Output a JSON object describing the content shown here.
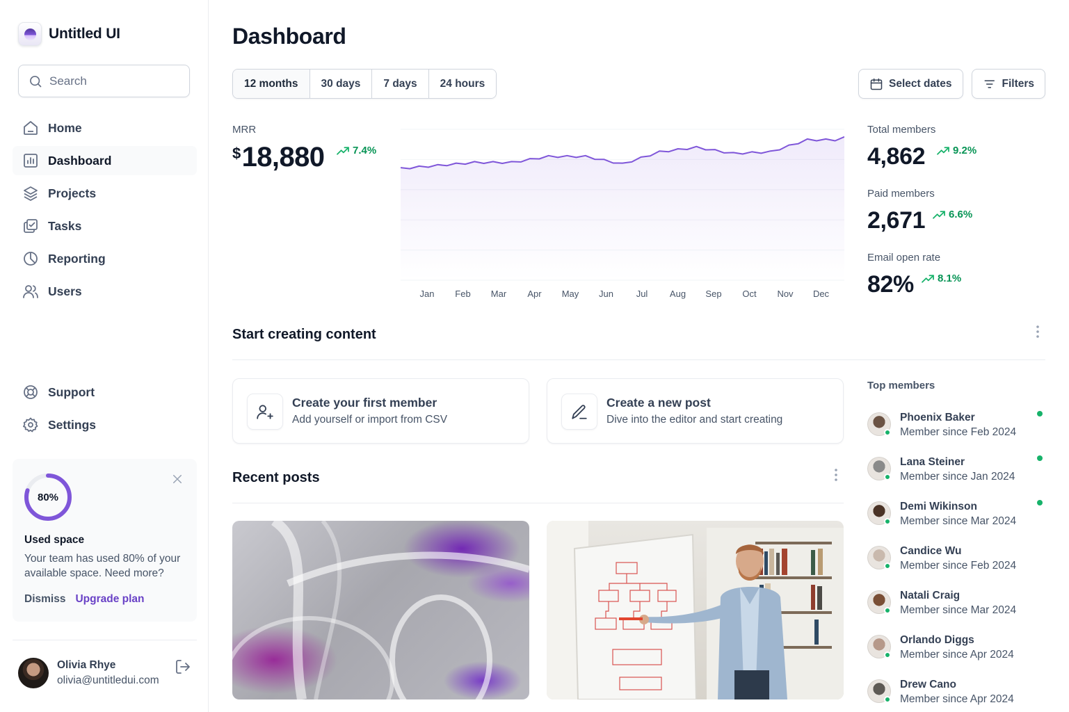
{
  "app": {
    "name": "Untitled UI"
  },
  "search": {
    "placeholder": "Search"
  },
  "sidebar": {
    "items": [
      {
        "label": "Home",
        "icon": "home-icon",
        "active": false
      },
      {
        "label": "Dashboard",
        "icon": "bar-chart-icon",
        "active": true
      },
      {
        "label": "Projects",
        "icon": "layers-icon",
        "active": false
      },
      {
        "label": "Tasks",
        "icon": "check-square-icon",
        "active": false
      },
      {
        "label": "Reporting",
        "icon": "pie-chart-icon",
        "active": false
      },
      {
        "label": "Users",
        "icon": "users-icon",
        "active": false
      }
    ],
    "bottom_items": [
      {
        "label": "Support",
        "icon": "life-buoy-icon"
      },
      {
        "label": "Settings",
        "icon": "settings-icon"
      }
    ],
    "usage": {
      "percent_label": "80%",
      "percent": 0.8,
      "title": "Used space",
      "text": "Your team has used 80% of your available space. Need more?",
      "dismiss": "Dismiss",
      "upgrade": "Upgrade plan"
    },
    "account": {
      "name": "Olivia Rhye",
      "email": "olivia@untitledui.com"
    }
  },
  "header": {
    "title": "Dashboard",
    "ranges": [
      "12 months",
      "30 days",
      "7 days",
      "24 hours"
    ],
    "active_range": "12 months",
    "select_dates": "Select dates",
    "filters": "Filters"
  },
  "mrr": {
    "label": "MRR",
    "currency": "$",
    "value": "18,880",
    "trend": "7.4%"
  },
  "chart_data": {
    "type": "area",
    "x": [
      "Jan",
      "Feb",
      "Mar",
      "Apr",
      "May",
      "Jun",
      "Jul",
      "Aug",
      "Sep",
      "Oct",
      "Nov",
      "Dec"
    ],
    "values": [
      0.74,
      0.76,
      0.78,
      0.78,
      0.82,
      0.82,
      0.77,
      0.85,
      0.88,
      0.84,
      0.85,
      0.93
    ],
    "ylim": [
      0,
      1
    ],
    "grid": true,
    "color": "#7f56d9"
  },
  "stats": [
    {
      "label": "Total members",
      "value": "4,862",
      "trend": "9.2%"
    },
    {
      "label": "Paid members",
      "value": "2,671",
      "trend": "6.6%"
    },
    {
      "label": "Email open rate",
      "value": "82%",
      "trend": "8.1%"
    }
  ],
  "start_content": {
    "title": "Start creating content",
    "cards": [
      {
        "title": "Create your first member",
        "subtitle": "Add yourself or import from CSV",
        "icon": "user-plus-icon"
      },
      {
        "title": "Create a new post",
        "subtitle": "Dive into the editor and start creating",
        "icon": "pen-icon"
      }
    ]
  },
  "recent_posts": {
    "title": "Recent posts"
  },
  "top_members": {
    "title": "Top members",
    "members": [
      {
        "name": "Phoenix Baker",
        "since": "Member since Feb 2024",
        "online": true,
        "avatar_color": "#6b5344"
      },
      {
        "name": "Lana Steiner",
        "since": "Member since Jan 2024",
        "online": true,
        "avatar_color": "#8a8a8a"
      },
      {
        "name": "Demi Wikinson",
        "since": "Member since Mar 2024",
        "online": true,
        "avatar_color": "#4a3326"
      },
      {
        "name": "Candice Wu",
        "since": "Member since Feb 2024",
        "online": false,
        "avatar_color": "#c9b9ad"
      },
      {
        "name": "Natali Craig",
        "since": "Member since Mar 2024",
        "online": false,
        "avatar_color": "#7a4f36"
      },
      {
        "name": "Orlando Diggs",
        "since": "Member since Apr 2024",
        "online": false,
        "avatar_color": "#b6998a"
      },
      {
        "name": "Drew Cano",
        "since": "Member since Apr 2024",
        "online": false,
        "avatar_color": "#5e5a55"
      }
    ]
  }
}
